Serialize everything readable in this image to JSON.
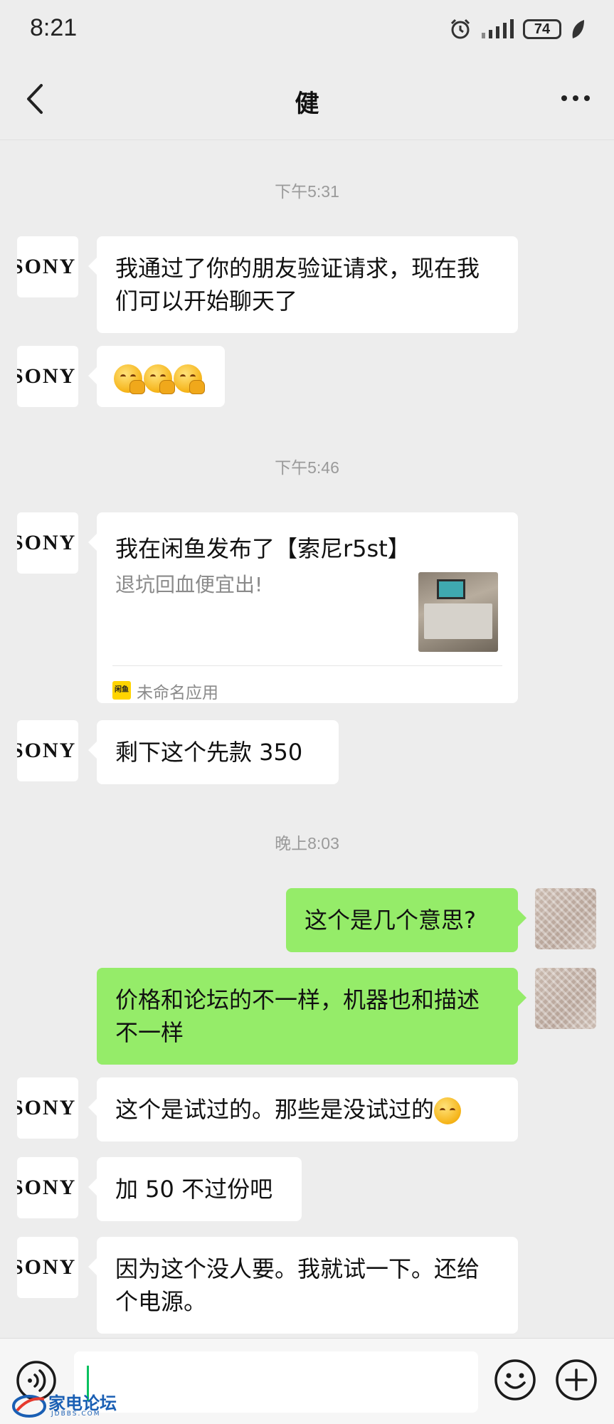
{
  "status_bar": {
    "time": "8:21",
    "battery": "74"
  },
  "header": {
    "title": "健"
  },
  "timestamps": [
    "下午5:31",
    "下午5:46",
    "晚上8:03"
  ],
  "avatar_text": "SONY",
  "messages": {
    "m1": "我通过了你的朋友验证请求，现在我们可以开始聊天了",
    "m4": "剩下这个先款 350",
    "m5": "这个是几个意思?",
    "m6": "价格和论坛的不一样，机器也和描述不一样",
    "m7": "这个是试过的。那些是没试过的",
    "m8": "加 50 不过份吧",
    "m9": "因为这个没人要。我就试一下。还给个电源。"
  },
  "share_card": {
    "title": "我在闲鱼发布了【索尼r5st】",
    "description": "退坑回血便宜出!",
    "app_name": "未命名应用",
    "app_icon_text": "闲鱼"
  },
  "watermark": {
    "text": "家电论坛",
    "sub": "JDBBS.COM"
  }
}
